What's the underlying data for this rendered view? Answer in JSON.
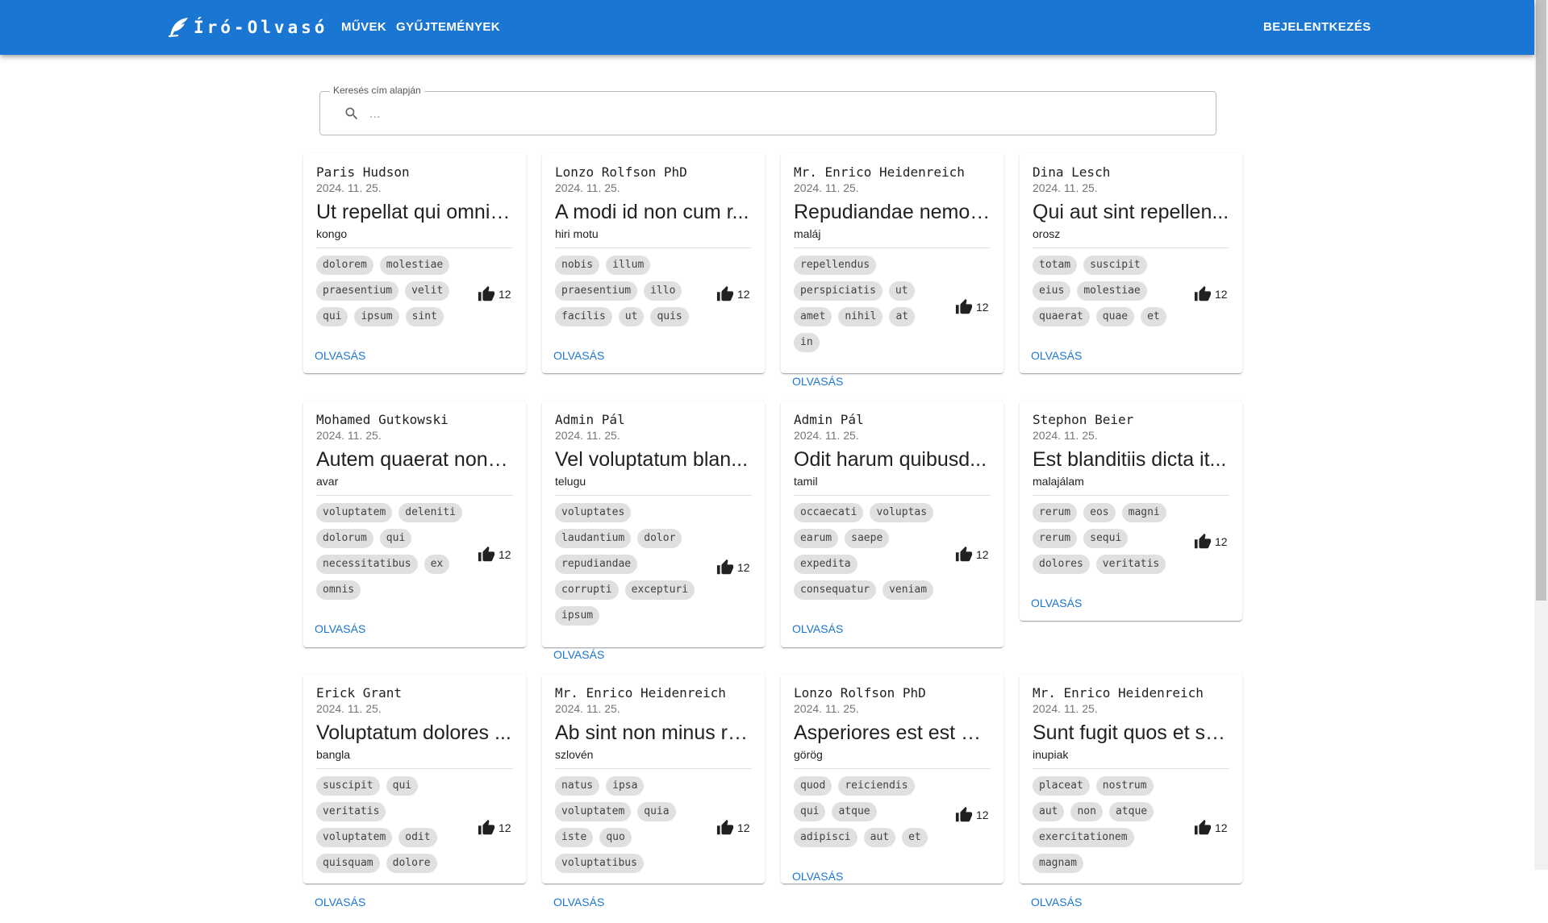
{
  "header": {
    "brand": "Író-Olvasó",
    "nav": [
      "MŰVEK",
      "GYŰJTEMÉNYEK"
    ],
    "login": "BEJELENTKEZÉS",
    "bar_color": "#1976d2"
  },
  "search": {
    "label": "Keresés cím alapján",
    "placeholder": "..."
  },
  "cards": [
    {
      "author": "Paris Hudson",
      "date": "2024. 11. 25.",
      "title": "Ut repellat qui omnis...",
      "lang": "kongo",
      "tags": [
        "dolorem",
        "molestiae",
        "praesentium",
        "velit",
        "qui",
        "ipsum",
        "sint"
      ],
      "likes": "12",
      "action": "OLVASÁS"
    },
    {
      "author": "Lonzo Rolfson PhD",
      "date": "2024. 11. 25.",
      "title": "A modi id non cum r...",
      "lang": "hiri motu",
      "tags": [
        "nobis",
        "illum",
        "praesentium",
        "illo",
        "facilis",
        "ut",
        "quis"
      ],
      "likes": "12",
      "action": "OLVASÁS"
    },
    {
      "author": "Mr. Enrico Heidenreich",
      "date": "2024. 11. 25.",
      "title": "Repudiandae nemo ...",
      "lang": "maláj",
      "tags": [
        "repellendus",
        "perspiciatis",
        "ut",
        "amet",
        "nihil",
        "at",
        "in"
      ],
      "likes": "12",
      "action": "OLVASÁS"
    },
    {
      "author": "Dina Lesch",
      "date": "2024. 11. 25.",
      "title": "Qui aut sint repellen...",
      "lang": "orosz",
      "tags": [
        "totam",
        "suscipit",
        "eius",
        "molestiae",
        "quaerat",
        "quae",
        "et"
      ],
      "likes": "12",
      "action": "OLVASÁS"
    },
    {
      "author": "Mohamed Gutkowski",
      "date": "2024. 11. 25.",
      "title": "Autem quaerat non i...",
      "lang": "avar",
      "tags": [
        "voluptatem",
        "deleniti",
        "dolorum",
        "qui",
        "necessitatibus",
        "ex",
        "omnis"
      ],
      "likes": "12",
      "action": "OLVASÁS"
    },
    {
      "author": "Admin Pál",
      "date": "2024. 11. 25.",
      "title": "Vel voluptatum blan...",
      "lang": "telugu",
      "tags": [
        "voluptates",
        "laudantium",
        "dolor",
        "repudiandae",
        "corrupti",
        "excepturi",
        "ipsum"
      ],
      "likes": "12",
      "action": "OLVASÁS"
    },
    {
      "author": "Admin Pál",
      "date": "2024. 11. 25.",
      "title": "Odit harum quibusd...",
      "lang": "tamil",
      "tags": [
        "occaecati",
        "voluptas",
        "earum",
        "saepe",
        "expedita",
        "consequatur",
        "veniam"
      ],
      "likes": "12",
      "action": "OLVASÁS"
    },
    {
      "author": "Stephon Beier",
      "date": "2024. 11. 25.",
      "title": "Est blanditiis dicta it...",
      "lang": "malajálam",
      "tags": [
        "rerum",
        "eos",
        "magni",
        "rerum",
        "sequi",
        "dolores",
        "veritatis"
      ],
      "likes": "12",
      "action": "OLVASÁS"
    },
    {
      "author": "Erick Grant",
      "date": "2024. 11. 25.",
      "title": "Voluptatum dolores ...",
      "lang": "bangla",
      "tags": [
        "suscipit",
        "qui",
        "veritatis",
        "voluptatem",
        "odit",
        "quisquam",
        "dolore"
      ],
      "likes": "12",
      "action": "OLVASÁS"
    },
    {
      "author": "Mr. Enrico Heidenreich",
      "date": "2024. 11. 25.",
      "title": "Ab sint non minus re...",
      "lang": "szlovén",
      "tags": [
        "natus",
        "ipsa",
        "voluptatem",
        "quia",
        "iste",
        "quo",
        "voluptatibus"
      ],
      "likes": "12",
      "action": "OLVASÁS"
    },
    {
      "author": "Lonzo Rolfson PhD",
      "date": "2024. 11. 25.",
      "title": "Asperiores est est ut...",
      "lang": "görög",
      "tags": [
        "quod",
        "reiciendis",
        "qui",
        "atque",
        "adipisci",
        "aut",
        "et"
      ],
      "likes": "12",
      "action": "OLVASÁS"
    },
    {
      "author": "Mr. Enrico Heidenreich",
      "date": "2024. 11. 25.",
      "title": "Sunt fugit quos et so...",
      "lang": "inupiak",
      "tags": [
        "placeat",
        "nostrum",
        "aut",
        "non",
        "atque",
        "exercitationem",
        "magnam"
      ],
      "likes": "12",
      "action": "OLVASÁS"
    }
  ]
}
